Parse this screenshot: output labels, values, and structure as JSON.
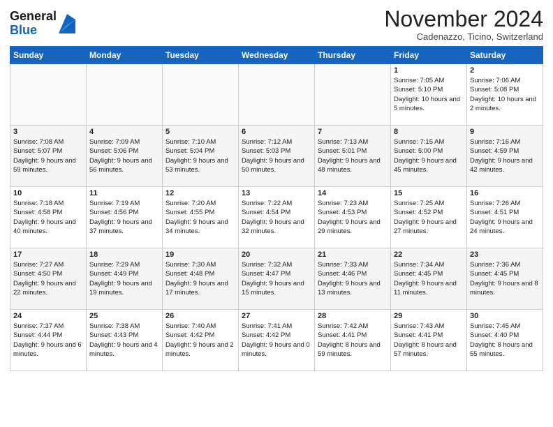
{
  "header": {
    "logo_general": "General",
    "logo_blue": "Blue",
    "title": "November 2024",
    "location": "Cadenazzo, Ticino, Switzerland"
  },
  "weekdays": [
    "Sunday",
    "Monday",
    "Tuesday",
    "Wednesday",
    "Thursday",
    "Friday",
    "Saturday"
  ],
  "weeks": [
    [
      {
        "day": "",
        "text": ""
      },
      {
        "day": "",
        "text": ""
      },
      {
        "day": "",
        "text": ""
      },
      {
        "day": "",
        "text": ""
      },
      {
        "day": "",
        "text": ""
      },
      {
        "day": "1",
        "text": "Sunrise: 7:05 AM\nSunset: 5:10 PM\nDaylight: 10 hours and 5 minutes."
      },
      {
        "day": "2",
        "text": "Sunrise: 7:06 AM\nSunset: 5:08 PM\nDaylight: 10 hours and 2 minutes."
      }
    ],
    [
      {
        "day": "3",
        "text": "Sunrise: 7:08 AM\nSunset: 5:07 PM\nDaylight: 9 hours and 59 minutes."
      },
      {
        "day": "4",
        "text": "Sunrise: 7:09 AM\nSunset: 5:06 PM\nDaylight: 9 hours and 56 minutes."
      },
      {
        "day": "5",
        "text": "Sunrise: 7:10 AM\nSunset: 5:04 PM\nDaylight: 9 hours and 53 minutes."
      },
      {
        "day": "6",
        "text": "Sunrise: 7:12 AM\nSunset: 5:03 PM\nDaylight: 9 hours and 50 minutes."
      },
      {
        "day": "7",
        "text": "Sunrise: 7:13 AM\nSunset: 5:01 PM\nDaylight: 9 hours and 48 minutes."
      },
      {
        "day": "8",
        "text": "Sunrise: 7:15 AM\nSunset: 5:00 PM\nDaylight: 9 hours and 45 minutes."
      },
      {
        "day": "9",
        "text": "Sunrise: 7:16 AM\nSunset: 4:59 PM\nDaylight: 9 hours and 42 minutes."
      }
    ],
    [
      {
        "day": "10",
        "text": "Sunrise: 7:18 AM\nSunset: 4:58 PM\nDaylight: 9 hours and 40 minutes."
      },
      {
        "day": "11",
        "text": "Sunrise: 7:19 AM\nSunset: 4:56 PM\nDaylight: 9 hours and 37 minutes."
      },
      {
        "day": "12",
        "text": "Sunrise: 7:20 AM\nSunset: 4:55 PM\nDaylight: 9 hours and 34 minutes."
      },
      {
        "day": "13",
        "text": "Sunrise: 7:22 AM\nSunset: 4:54 PM\nDaylight: 9 hours and 32 minutes."
      },
      {
        "day": "14",
        "text": "Sunrise: 7:23 AM\nSunset: 4:53 PM\nDaylight: 9 hours and 29 minutes."
      },
      {
        "day": "15",
        "text": "Sunrise: 7:25 AM\nSunset: 4:52 PM\nDaylight: 9 hours and 27 minutes."
      },
      {
        "day": "16",
        "text": "Sunrise: 7:26 AM\nSunset: 4:51 PM\nDaylight: 9 hours and 24 minutes."
      }
    ],
    [
      {
        "day": "17",
        "text": "Sunrise: 7:27 AM\nSunset: 4:50 PM\nDaylight: 9 hours and 22 minutes."
      },
      {
        "day": "18",
        "text": "Sunrise: 7:29 AM\nSunset: 4:49 PM\nDaylight: 9 hours and 19 minutes."
      },
      {
        "day": "19",
        "text": "Sunrise: 7:30 AM\nSunset: 4:48 PM\nDaylight: 9 hours and 17 minutes."
      },
      {
        "day": "20",
        "text": "Sunrise: 7:32 AM\nSunset: 4:47 PM\nDaylight: 9 hours and 15 minutes."
      },
      {
        "day": "21",
        "text": "Sunrise: 7:33 AM\nSunset: 4:46 PM\nDaylight: 9 hours and 13 minutes."
      },
      {
        "day": "22",
        "text": "Sunrise: 7:34 AM\nSunset: 4:45 PM\nDaylight: 9 hours and 11 minutes."
      },
      {
        "day": "23",
        "text": "Sunrise: 7:36 AM\nSunset: 4:45 PM\nDaylight: 9 hours and 8 minutes."
      }
    ],
    [
      {
        "day": "24",
        "text": "Sunrise: 7:37 AM\nSunset: 4:44 PM\nDaylight: 9 hours and 6 minutes."
      },
      {
        "day": "25",
        "text": "Sunrise: 7:38 AM\nSunset: 4:43 PM\nDaylight: 9 hours and 4 minutes."
      },
      {
        "day": "26",
        "text": "Sunrise: 7:40 AM\nSunset: 4:42 PM\nDaylight: 9 hours and 2 minutes."
      },
      {
        "day": "27",
        "text": "Sunrise: 7:41 AM\nSunset: 4:42 PM\nDaylight: 9 hours and 0 minutes."
      },
      {
        "day": "28",
        "text": "Sunrise: 7:42 AM\nSunset: 4:41 PM\nDaylight: 8 hours and 59 minutes."
      },
      {
        "day": "29",
        "text": "Sunrise: 7:43 AM\nSunset: 4:41 PM\nDaylight: 8 hours and 57 minutes."
      },
      {
        "day": "30",
        "text": "Sunrise: 7:45 AM\nSunset: 4:40 PM\nDaylight: 8 hours and 55 minutes."
      }
    ]
  ]
}
